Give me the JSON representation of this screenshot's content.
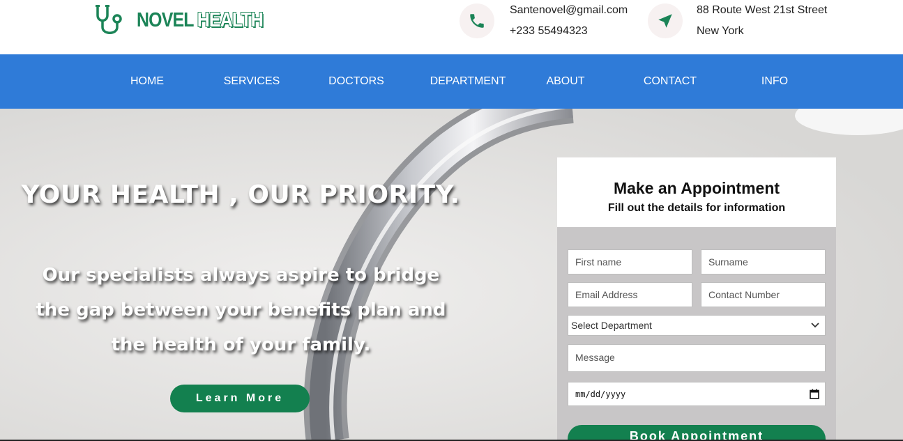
{
  "header": {
    "brand_part1": "NOVEL",
    "brand_part2": "HEALTH",
    "logo_icon": "stethoscope-icon",
    "email": "Santenovel@gmail.com",
    "phone": "+233 55494323",
    "address_line1": "88 Route West 21st Street",
    "address_line2": "New York",
    "phone_icon": "phone-icon",
    "location_icon": "location-arrow-icon"
  },
  "nav": {
    "items": [
      "HOME",
      "SERVICES",
      "DOCTORS",
      "DEPARTMENT",
      "ABOUT",
      "CONTACT",
      "INFO"
    ]
  },
  "hero": {
    "title": "YOUR HEALTH , OUR PRIORITY.",
    "subtitle": "Our specialists always aspire to bridge the gap between your benefits plan and the health of your family.",
    "cta_label": "Learn More"
  },
  "appointment": {
    "title": "Make an Appointment",
    "subtitle": "Fill out the details for information",
    "first_name_placeholder": "First name",
    "surname_placeholder": "Surname",
    "email_placeholder": "Email Address",
    "contact_placeholder": "Contact Number",
    "department_selected": "Select Department",
    "message_placeholder": "Message",
    "date_placeholder": "mm/dd/yyyy",
    "submit_label": "Book Appointment"
  },
  "colors": {
    "brand_green": "#1b8457",
    "nav_blue": "#2f7bd8",
    "button_green": "#13804f",
    "form_panel": "#c8c6c7"
  }
}
